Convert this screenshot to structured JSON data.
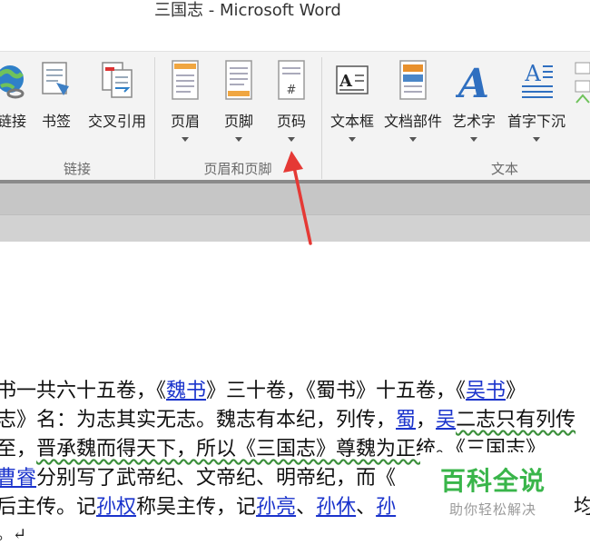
{
  "window": {
    "title": "三国志 - Microsoft Word"
  },
  "ribbon": {
    "groups": [
      {
        "label": "链接"
      },
      {
        "label": "页眉和页脚"
      },
      {
        "label": "文本"
      }
    ],
    "buttons": {
      "hyperlink": "链接",
      "bookmark": "书签",
      "cross_reference": "交叉引用",
      "header": "页眉",
      "footer": "页脚",
      "page_number": "页码",
      "text_box": "文本框",
      "quick_parts": "文档部件",
      "wordart": "艺术字",
      "drop_cap": "首字下沉"
    }
  },
  "document": {
    "line1": {
      "a": "书一共六十五卷，《",
      "b": "魏书",
      "c": "》三十卷，《蜀书》十五卷，《",
      "d": "吴书",
      "e": "》"
    },
    "line2": {
      "a": "志》名：为志其实无志。魏志有本纪，列传，",
      "b": "蜀",
      "c": "，",
      "d": "吴",
      "e": "二志只有列传"
    },
    "line3": {
      "a": "至，",
      "b": "晋承魏而得天下，所以《三国志》尊魏为正统。《三国志》"
    },
    "line4": {
      "a": "曹睿",
      "b": "分别写了武帝纪、文帝纪、明帝纪，而《"
    },
    "line5": {
      "a": "后主传。记",
      "b": "孙权",
      "c": "称吴主传，记",
      "d": "孙亮",
      "e": "、",
      "f": "孙休",
      "g": "、",
      "h": "孙",
      "i": "均"
    },
    "line6": "。↵"
  },
  "watermark": {
    "title": "百科全说",
    "subtitle": "助你轻松解决"
  },
  "colors": {
    "annotation_arrow": "#e53935",
    "link": "#1a33cc",
    "brand_green": "#39b54a"
  }
}
